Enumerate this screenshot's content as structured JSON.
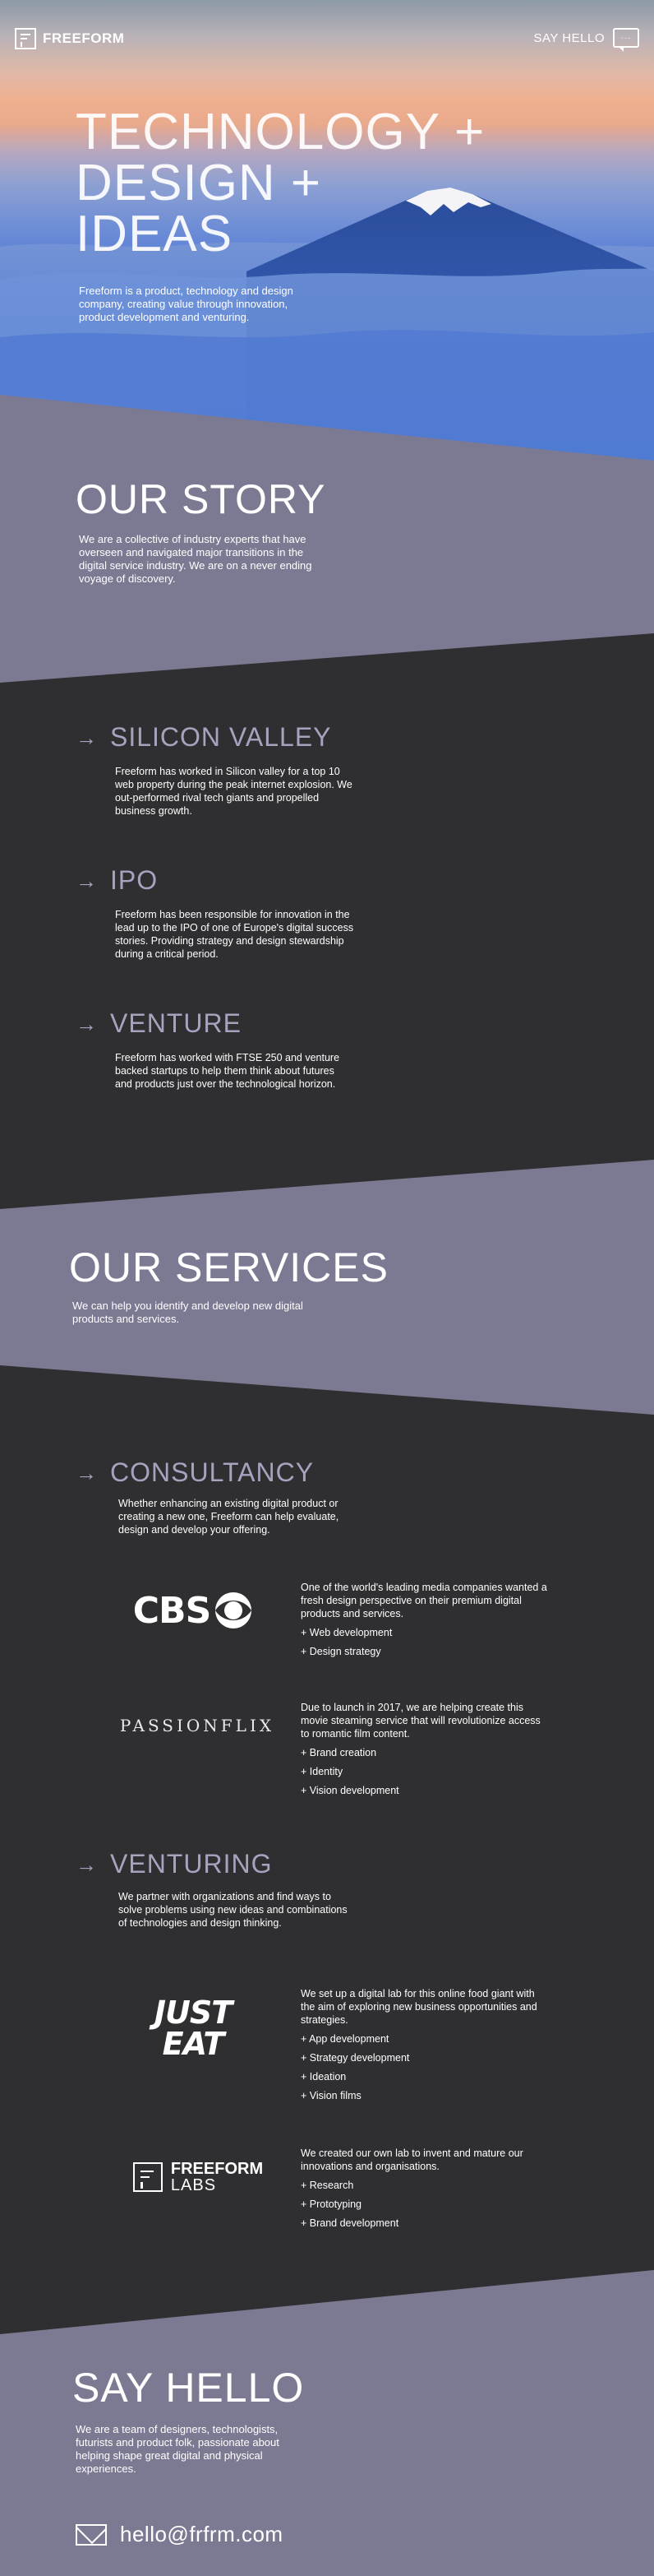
{
  "header": {
    "logo_text": "FREEFORM",
    "say_hello_label": "SAY HELLO",
    "chat_icon_glyph": "···"
  },
  "hero": {
    "title_lines": [
      "TECHNOLOGY +",
      "DESIGN +",
      "IDEAS"
    ],
    "text": "Freeform is a product, technology and design company, creating value through innovation, product development and venturing."
  },
  "story": {
    "title": "OUR STORY",
    "text": "We are a collective of industry experts that have overseen and navigated major transitions in the digital service industry. We are on a never ending voyage of discovery.",
    "items": [
      {
        "title": "SILICON VALLEY",
        "text": "Freeform has worked in Silicon valley for a top 10 web property during the peak internet explosion. We out-performed rival tech giants and propelled business growth."
      },
      {
        "title": "IPO",
        "text": "Freeform has been responsible for innovation in the lead up to the IPO of one of Europe's digital success stories. Providing strategy and design stewardship during a critical period."
      },
      {
        "title": "VENTURE",
        "text": "Freeform has worked with FTSE 250 and venture backed startups to help them think about futures and products just over the technological horizon."
      }
    ]
  },
  "services": {
    "title": "OUR SERVICES",
    "text": "We can help you identify and develop new digital products and services.",
    "consultancy": {
      "title": "CONSULTANCY",
      "text": "Whether enhancing an existing digital product or creating a new one, Freeform can help evaluate, design and develop your offering.",
      "clients": [
        {
          "logo": "CBS",
          "intro": "One of the world's leading media companies wanted a fresh design perspective on their premium digital products and services.",
          "bullets": [
            "+ Web development",
            "+ Design strategy"
          ]
        },
        {
          "logo": "PASSIONFLIX",
          "intro": "Due to launch in 2017, we are helping create this movie steaming service that will revolutionize access to romantic film content.",
          "bullets": [
            "+ Brand creation",
            "+ Identity",
            "+ Vision development"
          ]
        }
      ]
    },
    "venturing": {
      "title": "VENTURING",
      "text": "We partner with organizations and find ways to solve problems using new ideas and combinations of technologies and design thinking.",
      "clients": [
        {
          "logo_lines": [
            "JUST",
            "EAT"
          ],
          "intro": "We set up a digital lab for this online food giant with the aim of exploring new business opportunities and strategies.",
          "bullets": [
            "+ App development",
            "+ Strategy development",
            "+ Ideation",
            "+ Vision films"
          ]
        },
        {
          "logo_lines": [
            "FREEFORM",
            "LABS"
          ],
          "intro": "We created our own lab to invent and mature our innovations and organisations.",
          "bullets": [
            "+ Research",
            "+ Prototyping",
            "+ Brand development"
          ]
        }
      ]
    }
  },
  "contact": {
    "title": "SAY HELLO",
    "text": "We are a team of designers, technologists, futurists and product folk, passionate about helping shape great digital and physical experiences.",
    "email": "hello@frfrm.com"
  },
  "colors": {
    "purple_band": "#7c7a93",
    "dark_band": "#2f2f31",
    "accent_lilac": "#a7a3bf"
  }
}
